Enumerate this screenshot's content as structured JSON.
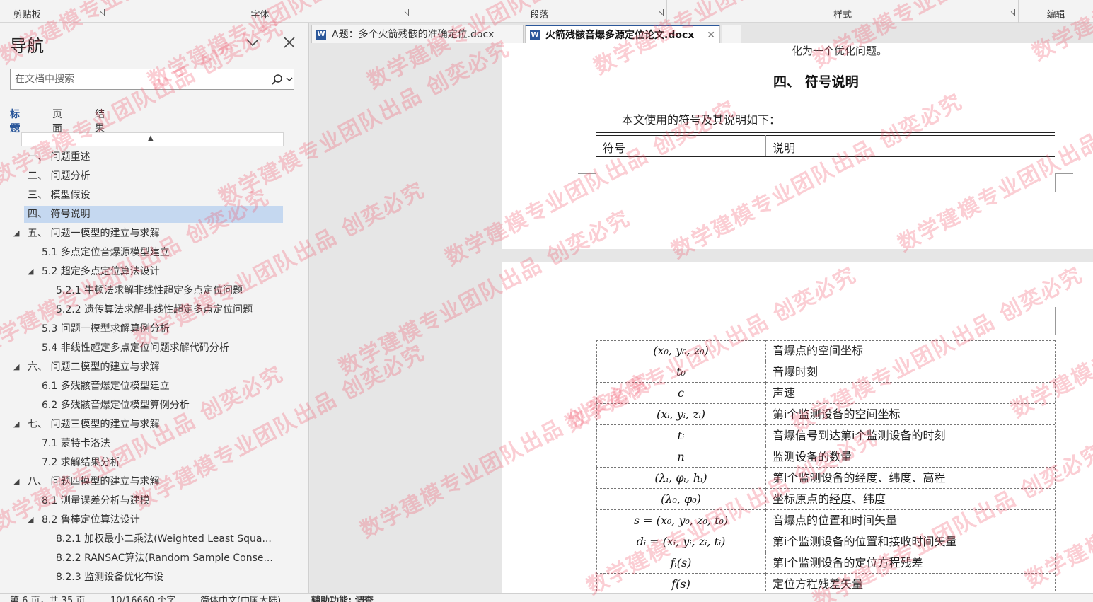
{
  "ribbon": {
    "groups": [
      {
        "label": "剪贴板"
      },
      {
        "label": "字体"
      },
      {
        "label": "段落"
      },
      {
        "label": "样式"
      },
      {
        "label": "编辑"
      }
    ]
  },
  "nav": {
    "title": "导航",
    "search_placeholder": "在文档中搜索",
    "tabs": [
      {
        "label": "标题",
        "active": true
      },
      {
        "label": "页面",
        "active": false
      },
      {
        "label": "结果",
        "active": false
      }
    ],
    "items": [
      {
        "label": "一、 问题重述",
        "level": 1,
        "expandable": false,
        "selected": false
      },
      {
        "label": "二、 问题分析",
        "level": 1,
        "expandable": false,
        "selected": false
      },
      {
        "label": "三、 模型假设",
        "level": 1,
        "expandable": false,
        "selected": false
      },
      {
        "label": "四、 符号说明",
        "level": 1,
        "expandable": false,
        "selected": true
      },
      {
        "label": "五、 问题一模型的建立与求解",
        "level": 1,
        "expandable": true,
        "selected": false
      },
      {
        "label": "5.1 多点定位音爆源模型建立",
        "level": 2,
        "expandable": false,
        "selected": false
      },
      {
        "label": "5.2 超定多点定位算法设计",
        "level": 2,
        "expandable": true,
        "selected": false
      },
      {
        "label": "5.2.1 牛顿法求解非线性超定多点定位问题",
        "level": 3,
        "expandable": false,
        "selected": false
      },
      {
        "label": "5.2.2 遗传算法求解非线性超定多点定位问题",
        "level": 3,
        "expandable": false,
        "selected": false
      },
      {
        "label": "5.3 问题一模型求解算例分析",
        "level": 2,
        "expandable": false,
        "selected": false
      },
      {
        "label": "5.4 非线性超定多点定位问题求解代码分析",
        "level": 2,
        "expandable": false,
        "selected": false
      },
      {
        "label": "六、 问题二模型的建立与求解",
        "level": 1,
        "expandable": true,
        "selected": false
      },
      {
        "label": "6.1 多残骸音爆定位模型建立",
        "level": 2,
        "expandable": false,
        "selected": false
      },
      {
        "label": "6.2 多残骸音爆定位模型算例分析",
        "level": 2,
        "expandable": false,
        "selected": false
      },
      {
        "label": "七、 问题三模型的建立与求解",
        "level": 1,
        "expandable": true,
        "selected": false
      },
      {
        "label": "7.1 蒙特卡洛法",
        "level": 2,
        "expandable": false,
        "selected": false
      },
      {
        "label": "7.2 求解结果分析",
        "level": 2,
        "expandable": false,
        "selected": false
      },
      {
        "label": "八、 问题四模型的建立与求解",
        "level": 1,
        "expandable": true,
        "selected": false
      },
      {
        "label": "8.1 测量误差分析与建模",
        "level": 2,
        "expandable": false,
        "selected": false
      },
      {
        "label": "8.2 鲁棒定位算法设计",
        "level": 2,
        "expandable": true,
        "selected": false
      },
      {
        "label": "8.2.1 加权最小二乘法(Weighted Least Squa...",
        "level": 3,
        "expandable": false,
        "selected": false
      },
      {
        "label": "8.2.2 RANSAC算法(Random Sample Conse...",
        "level": 3,
        "expandable": false,
        "selected": false
      },
      {
        "label": "8.2.3 监测设备优化布设",
        "level": 3,
        "expandable": false,
        "selected": false
      }
    ]
  },
  "doc_tabs": [
    {
      "label": "A题：多个火箭残骸的准确定位.docx",
      "active": false
    },
    {
      "label": "火箭残骸音爆多源定位论文.docx",
      "active": true
    }
  ],
  "document": {
    "cut_text": "化为一个优化问题。",
    "heading": "四、   符号说明",
    "intro": "本文使用的符号及其说明如下：",
    "table_header": {
      "symbol": "符号",
      "description": "说明"
    },
    "rows": [
      {
        "symbol": "(x₀, y₀, z₀)",
        "description": "音爆点的空间坐标"
      },
      {
        "symbol": "t₀",
        "description": "音爆时刻"
      },
      {
        "symbol": "c",
        "description": "声速"
      },
      {
        "symbol": "(xᵢ, yᵢ, zᵢ)",
        "description": "第i个监测设备的空间坐标"
      },
      {
        "symbol": "tᵢ",
        "description": "音爆信号到达第i个监测设备的时刻"
      },
      {
        "symbol": "n",
        "description": "监测设备的数量"
      },
      {
        "symbol": "(λᵢ, φᵢ, hᵢ)",
        "description": "第i个监测设备的经度、纬度、高程"
      },
      {
        "symbol": "(λ₀, φ₀)",
        "description": "坐标原点的经度、纬度"
      },
      {
        "symbol": "s = (x₀, y₀, z₀, t₀)",
        "description": "音爆点的位置和时间矢量"
      },
      {
        "symbol": "dᵢ = (xᵢ, yᵢ, zᵢ, tᵢ)",
        "description": "第i个监测设备的位置和接收时间矢量"
      },
      {
        "symbol": "fᵢ(s)",
        "description": "第i个监测设备的定位方程残差"
      },
      {
        "symbol": "f(s)",
        "description": "定位方程残差矢量"
      }
    ]
  },
  "status": {
    "page": "第 6 页，共 35 页",
    "words": "10/16660 个字",
    "language": "简体中文(中国大陆)",
    "accessibility": "辅助功能: 调查"
  },
  "watermark": {
    "text": "数学建模专业团队出品 创奕必究"
  },
  "colors": {
    "accent": "#2b579a",
    "selected_item": "#c5d8f0",
    "watermark": "#f05064"
  }
}
